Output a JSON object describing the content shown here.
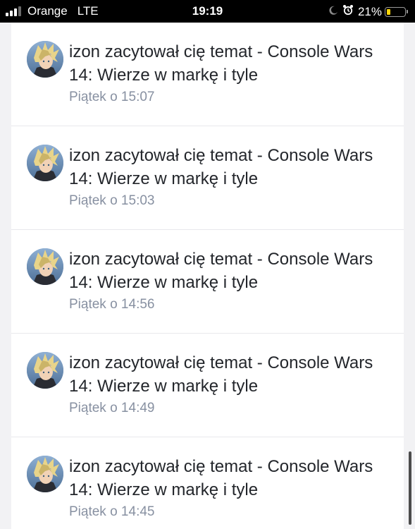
{
  "status_bar": {
    "carrier": "Orange",
    "network": "LTE",
    "time": "19:19",
    "battery_text": "21%",
    "battery_level": 0.21,
    "signal_bars_active": 3,
    "signal_bars_total": 4,
    "icons": [
      "signal-icon",
      "moon-icon",
      "alarm-icon",
      "battery-icon"
    ],
    "battery_color": "#ffd60a"
  },
  "notifications": [
    {
      "title": "izon zacytował cię temat - Console Wars 14: Wierze w markę i tyle",
      "time": "Piątek o 15:07"
    },
    {
      "title": "izon zacytował cię temat - Console Wars 14: Wierze w markę i tyle",
      "time": "Piątek o 15:03"
    },
    {
      "title": "izon zacytował cię temat - Console Wars 14: Wierze w markę i tyle",
      "time": "Piątek o 14:56"
    },
    {
      "title": "izon zacytował cię temat - Console Wars 14: Wierze w markę i tyle",
      "time": "Piątek o 14:49"
    },
    {
      "title": "izon zacytował cię temat - Console Wars 14: Wierze w markę i tyle",
      "time": "Piątek o 14:45"
    }
  ],
  "colors": {
    "title_text": "#23262b",
    "time_text": "#8790a1",
    "divider": "#e8e8ec"
  }
}
